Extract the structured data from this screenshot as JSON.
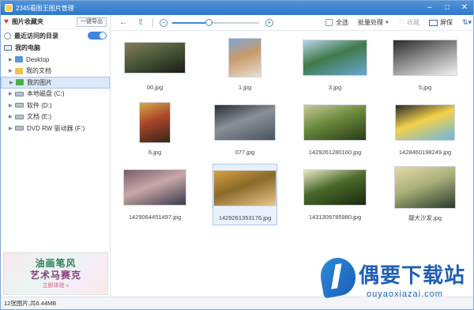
{
  "window": {
    "title": "2345看图王图片管理"
  },
  "sidebar": {
    "favorites_title": "图片收藏夹",
    "export_label": "一键导出",
    "recent_label": "最近访问的目录",
    "my_computer_label": "我的电脑",
    "tree": [
      {
        "label": "Desktop",
        "icon": "folder-blue-icon"
      },
      {
        "label": "我的文档",
        "icon": "folder-icon"
      },
      {
        "label": "我的图片",
        "icon": "folder-green-icon",
        "selected": true
      },
      {
        "label": "本地磁盘 (C:)",
        "icon": "drive-icon"
      },
      {
        "label": "软件 (D:)",
        "icon": "drive-icon"
      },
      {
        "label": "文档 (E:)",
        "icon": "drive-icon"
      },
      {
        "label": "DVD RW 驱动器 (F:)",
        "icon": "dvd-drive-icon"
      }
    ],
    "ad": {
      "line1": "油画笔风",
      "line2": "艺术马赛克",
      "button": "立即体验 »"
    }
  },
  "toolbar": {
    "back_icon": "back-arrow-icon",
    "up_icon": "up-folder-icon",
    "zoom_level": 0.42,
    "select_all": "全选",
    "batch": "批量处理",
    "favorite": "收藏",
    "screen": "屏保",
    "sort_icon": "sort-icon"
  },
  "images": [
    {
      "name": "00.jpg",
      "palette": [
        "#1a1c18",
        "#4a5a3a",
        "#8a7a5a"
      ]
    },
    {
      "name": "1.jpg",
      "palette": [
        "#e9dfd2",
        "#c89a6a",
        "#7aa6d8"
      ]
    },
    {
      "name": "3.jpg",
      "palette": [
        "#6aa6d6",
        "#3f7a4a",
        "#b9d4e8"
      ]
    },
    {
      "name": "5.jpg",
      "palette": [
        "#f2f2f2",
        "#888888",
        "#2a2a2a"
      ]
    },
    {
      "name": "6.jpg",
      "palette": [
        "#3a2418",
        "#a8452a",
        "#d8a84a"
      ]
    },
    {
      "name": "077.jpg",
      "palette": [
        "#4a5260",
        "#8a9098",
        "#2a2e34"
      ]
    },
    {
      "name": "1429261280160.jpg",
      "palette": [
        "#2a3a1a",
        "#6a8a3a",
        "#c8c89a"
      ]
    },
    {
      "name": "1428460198249.jpg",
      "palette": [
        "#6ab6e8",
        "#f2d24a",
        "#2a2a2a"
      ]
    },
    {
      "name": "1429064451497.jpg",
      "palette": [
        "#3a3a4a",
        "#c8a8a8",
        "#7a5a6a"
      ]
    },
    {
      "name": "1429261353176.jpg",
      "palette": [
        "#e8c88a",
        "#8a6a2a",
        "#d8a040"
      ]
    },
    {
      "name": "1431309785980.jpg",
      "palette": [
        "#1a2a12",
        "#4a6a2a",
        "#e8e8c8"
      ]
    },
    {
      "name": "靓大沙发.jpg",
      "palette": [
        "#2a3a2a",
        "#a8b07a",
        "#e8d8a8"
      ]
    }
  ],
  "status": {
    "text": "12张图片,共6.44MB"
  },
  "watermark": {
    "title": "偶要下载站",
    "url": "ouyaoxiazai.com"
  }
}
